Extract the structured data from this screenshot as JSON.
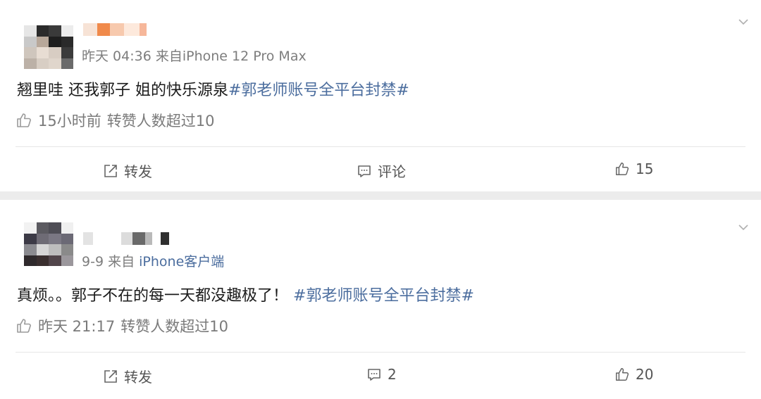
{
  "posts": [
    {
      "meta_time": "昨天 04:36",
      "meta_from": "来自",
      "meta_source": "iPhone 12 Pro Max",
      "content_text": "翘里哇 还我郭子 姐的快乐源泉",
      "content_hashtag": "#郭老师账号全平台封禁#",
      "stats_time": "15小时前",
      "stats_reposts": "转赞人数超过10",
      "actions": {
        "repost": "转发",
        "comment": "评论",
        "like": "15"
      }
    },
    {
      "meta_time": "9-9",
      "meta_from": "来自",
      "meta_source": "iPhone客户端",
      "content_text": "真烦。。郭子不在的每一天都没趣极了！",
      "content_hashtag": "#郭老师账号全平台封禁#",
      "stats_time": "昨天 21:17",
      "stats_reposts": "转赞人数超过10",
      "actions": {
        "repost": "转发",
        "comment": "2",
        "like": "20"
      }
    }
  ],
  "colors": {
    "link": "#4b6d9e",
    "meta": "#7d7d7d",
    "background": "#ececec",
    "card": "#ffffff"
  },
  "icons": [
    "thumbs-up-icon",
    "share-icon",
    "comment-icon",
    "chevron-down-icon"
  ]
}
